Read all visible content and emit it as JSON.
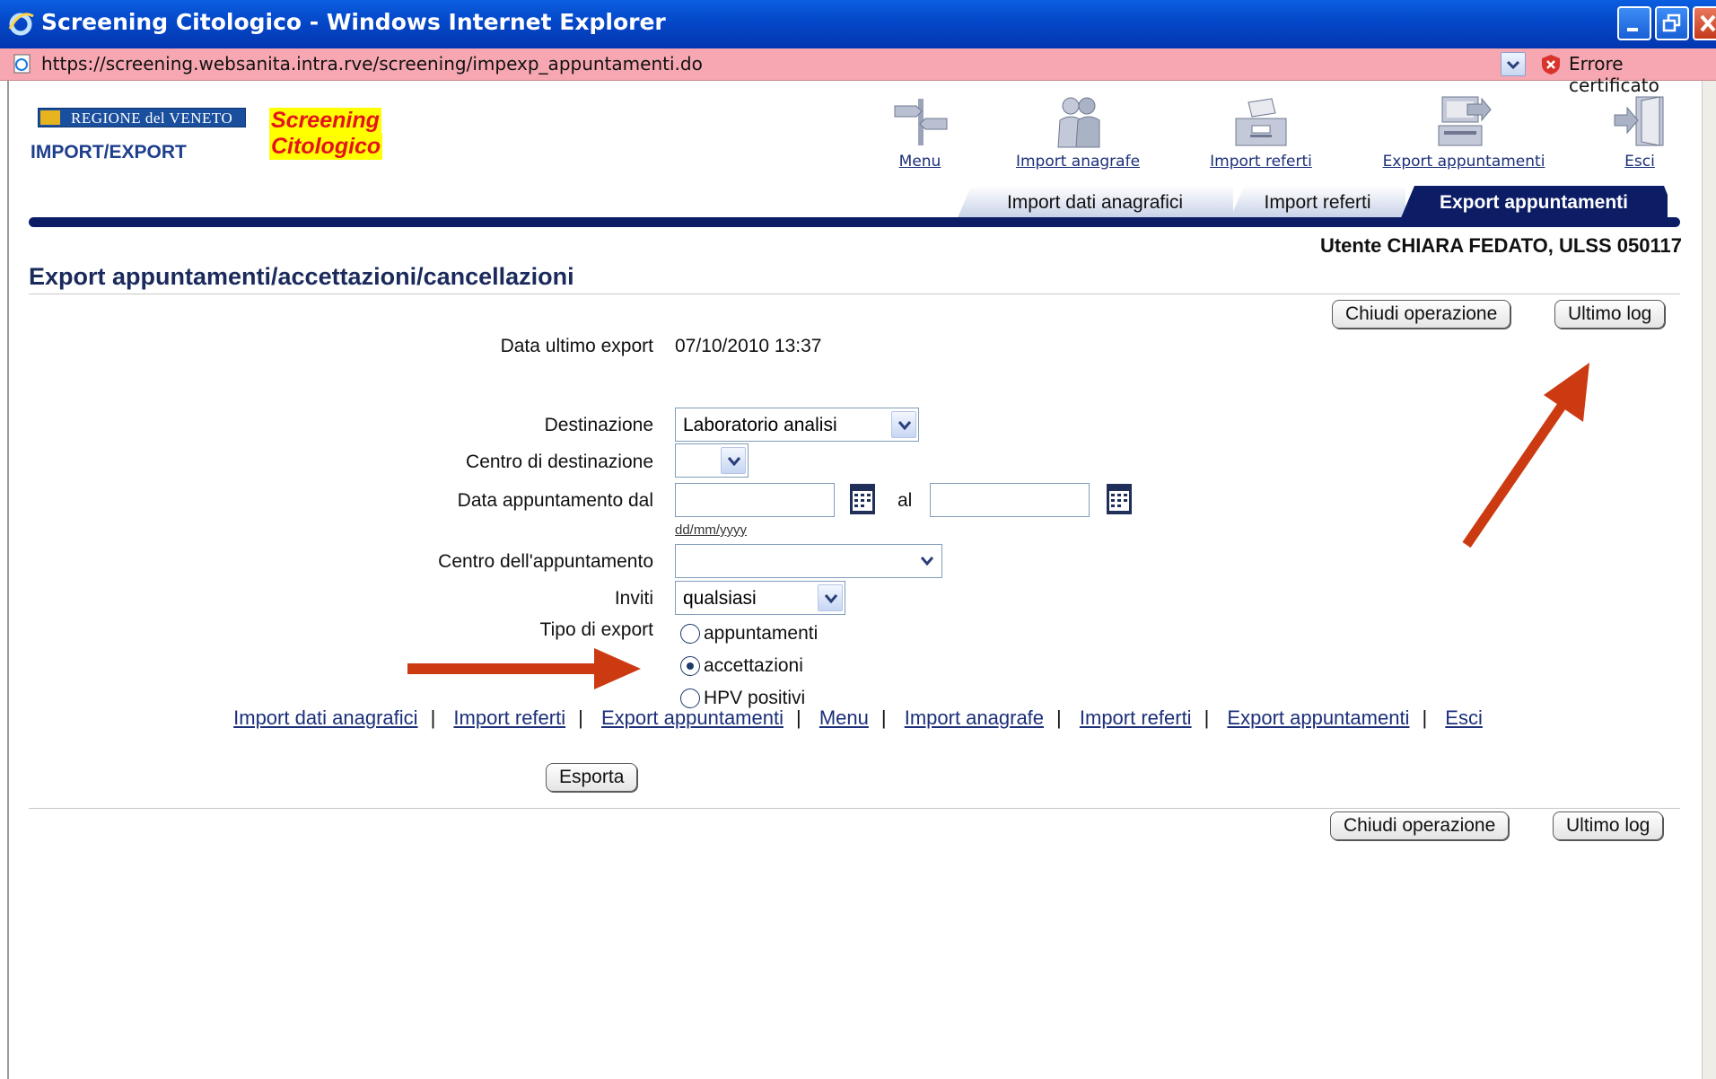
{
  "window": {
    "title": "Screening Citologico - Windows Internet Explorer",
    "url": "https://screening.websanita.intra.rve/screening/impexp_appuntamenti.do",
    "cert_error": "Errore certificato"
  },
  "header": {
    "region_logo": "REGIONE del VENETO",
    "module": "IMPORT/EXPORT",
    "brand_line1": "Screening",
    "brand_line2": "Citologico",
    "user": "Utente CHIARA FEDATO, ULSS 050117"
  },
  "nav_icons": [
    {
      "label": "Menu",
      "icon": "signpost-icon"
    },
    {
      "label": "Import anagrafe",
      "icon": "people-icon"
    },
    {
      "label": "Import referti",
      "icon": "inbox-icon"
    },
    {
      "label": "Export appuntamenti",
      "icon": "computer-export-icon"
    },
    {
      "label": "Esci",
      "icon": "exit-door-icon"
    }
  ],
  "tabs": [
    {
      "label": "Import dati anagrafici",
      "active": false
    },
    {
      "label": "Import referti",
      "active": false
    },
    {
      "label": "Export appuntamenti",
      "active": true
    }
  ],
  "main": {
    "title": "Export appuntamenti/accettazioni/cancellazioni",
    "close_button": "Chiudi operazione",
    "log_button": "Ultimo log",
    "last_export_label": "Data ultimo export",
    "last_export_value": "07/10/2010 13:37",
    "destinazione_label": "Destinazione",
    "destinazione_value": "Laboratorio analisi",
    "centro_dest_label": "Centro di destinazione",
    "centro_dest_value": "",
    "data_app_label": "Data appuntamento dal",
    "date_to_label": "al",
    "date_hint": "dd/mm/yyyy",
    "centro_app_label": "Centro dell'appuntamento",
    "centro_app_value": "",
    "inviti_label": "Inviti",
    "inviti_value": "qualsiasi",
    "tipo_label": "Tipo di export",
    "tipo_options": [
      "appuntamenti",
      "accettazioni",
      "HPV positivi"
    ],
    "tipo_selected": "accettazioni",
    "export_button": "Esporta"
  },
  "footer_links": [
    "Import dati anagrafici",
    "Import referti",
    "Export appuntamenti",
    "Menu",
    "Import anagrafe",
    "Import referti",
    "Export appuntamenti",
    "Esci"
  ],
  "colors": {
    "titlebar": "#0447c8",
    "address_error": "#f6a7b1",
    "nav_dark": "#0c1d66",
    "annotation_arrow": "#cc3a12",
    "brand_red": "#e4141c",
    "brand_yellow": "#ffff00"
  }
}
